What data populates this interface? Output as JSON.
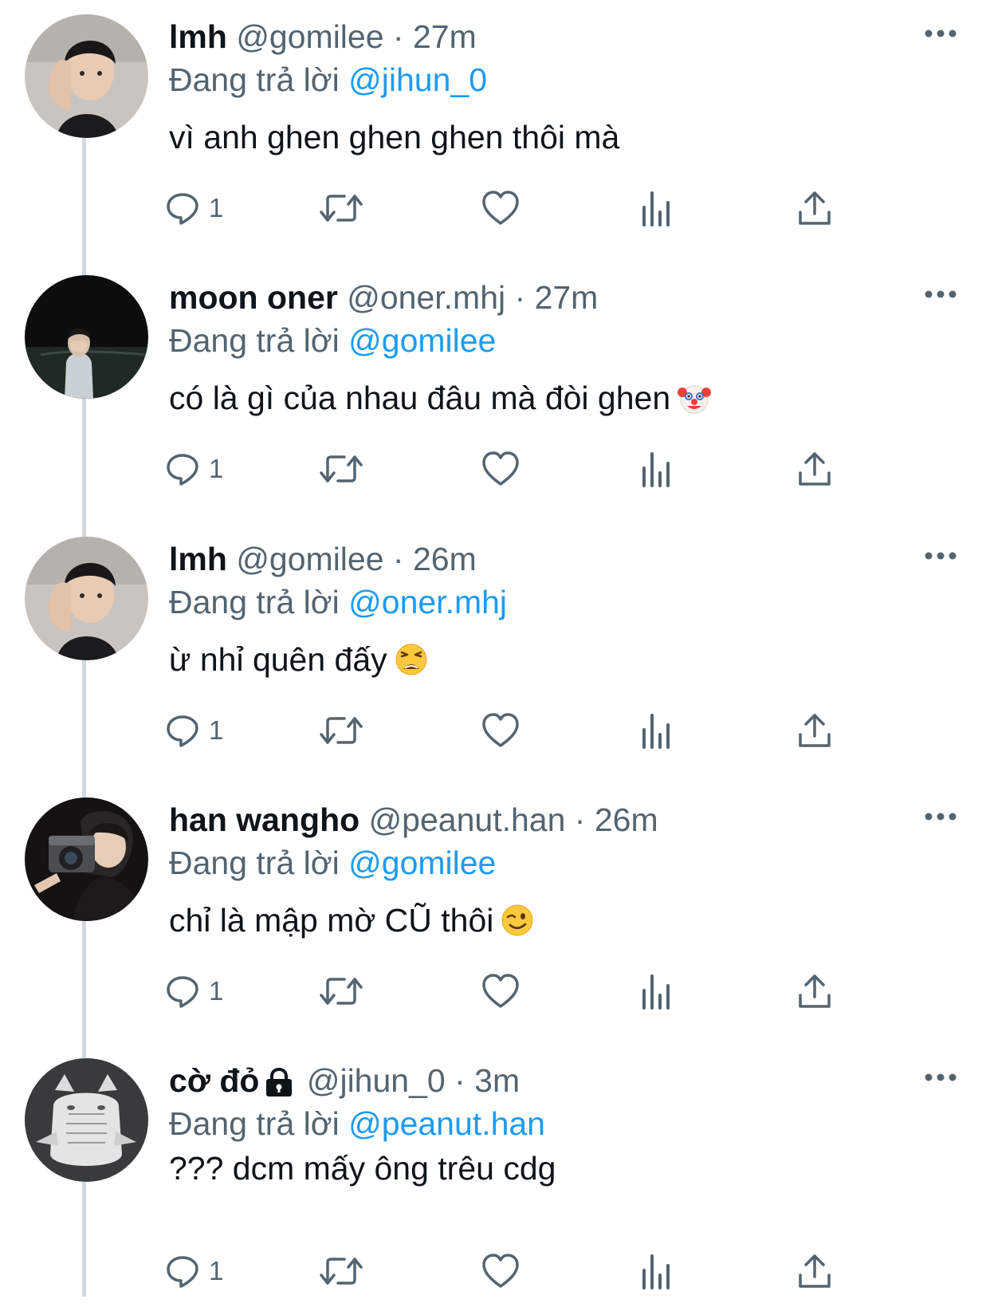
{
  "colors": {
    "text": "#0f1419",
    "secondary": "#536471",
    "link": "#1d9bf0",
    "thread_line": "#cfd9de"
  },
  "tweets": [
    {
      "name": "lmh",
      "handle": "@gomilee",
      "separator": "·",
      "time": "27m",
      "locked": false,
      "replying_prefix": "Đang trả lời",
      "replying_to": "@jihun_0",
      "text": "vì anh ghen ghen ghen thôi mà",
      "emoji": "",
      "reply_count": "1",
      "avatar_icon": "person-avatar"
    },
    {
      "name": "moon oner",
      "handle": "@oner.mhj",
      "separator": "·",
      "time": "27m",
      "locked": false,
      "replying_prefix": "Đang trả lời",
      "replying_to": "@gomilee",
      "text": "có là gì của nhau đâu mà đòi ghen",
      "emoji": "clown-face",
      "reply_count": "1",
      "avatar_icon": "person-night-avatar"
    },
    {
      "name": "lmh",
      "handle": "@gomilee",
      "separator": "·",
      "time": "26m",
      "locked": false,
      "replying_prefix": "Đang trả lời",
      "replying_to": "@oner.mhj",
      "text": "ừ nhỉ quên đấy",
      "emoji": "weary-face",
      "reply_count": "1",
      "avatar_icon": "person-avatar"
    },
    {
      "name": "han wangho",
      "handle": "@peanut.han",
      "separator": "·",
      "time": "26m",
      "locked": false,
      "replying_prefix": "Đang trả lời",
      "replying_to": "@gomilee",
      "text": "chỉ là mập mờ CŨ thôi",
      "emoji": "winking-face",
      "reply_count": "1",
      "avatar_icon": "camera-person-avatar"
    },
    {
      "name": "cờ đỏ",
      "handle": "@jihun_0",
      "separator": "·",
      "time": "3m",
      "locked": true,
      "replying_prefix": "Đang trả lời",
      "replying_to": "@peanut.han",
      "text": "??? dcm mấy ông trêu cdg",
      "emoji": "",
      "reply_count": "1",
      "avatar_icon": "cat-avatar"
    }
  ]
}
